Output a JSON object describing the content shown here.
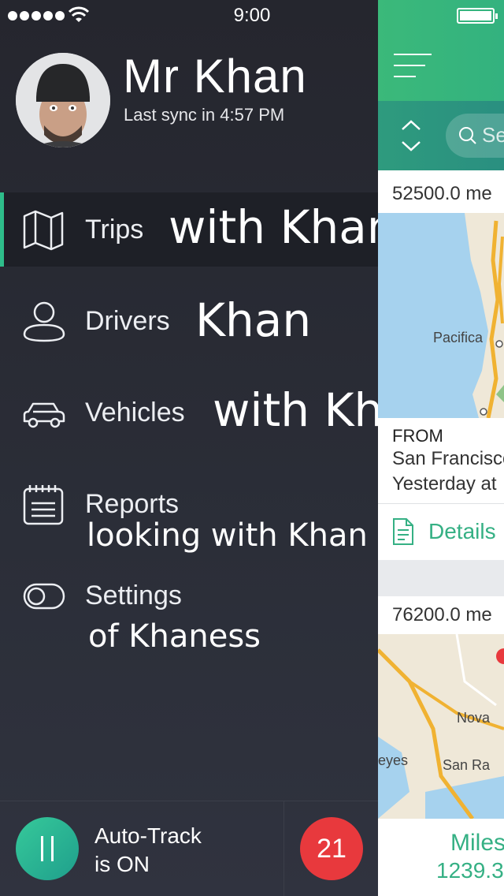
{
  "status_bar": {
    "time": "9:00"
  },
  "profile": {
    "name": "Mr Khan",
    "sync_text": "Last sync in 4:57 PM"
  },
  "menu": {
    "items": [
      {
        "label": "Trips",
        "icon": "map-icon",
        "active": true
      },
      {
        "label": "Drivers",
        "icon": "person-icon",
        "active": false
      },
      {
        "label": "Vehicles",
        "icon": "car-icon",
        "active": false
      },
      {
        "label": "Reports",
        "icon": "calendar-icon",
        "active": false
      },
      {
        "label": "Settings",
        "icon": "toggle-icon",
        "active": false
      }
    ]
  },
  "overlays": {
    "trips": "with Khan",
    "drivers": "Khan",
    "vehicles": "with Khan",
    "reports": "looking with Khan",
    "settings": "of Khaness"
  },
  "bottom": {
    "autotrack_line1": "Auto-Track",
    "autotrack_line2": "is ON",
    "badge_count": "21"
  },
  "main": {
    "search_placeholder": "Se",
    "trip1": {
      "distance": "52500.0 me",
      "map_label": "Pacifica",
      "from_label": "FROM",
      "from_place": "San Francisco",
      "from_time": "Yesterday at",
      "details": "Details"
    },
    "trip2": {
      "distance": "76200.0 me",
      "map_labels": [
        "Nova",
        "eyes",
        "San Ra"
      ]
    },
    "summary": {
      "miles_label": "Miles",
      "miles_value": "1239.3"
    }
  },
  "colors": {
    "accent": "#35b084",
    "badge": "#e8393d",
    "drawer_bg": "#2a2d36"
  }
}
